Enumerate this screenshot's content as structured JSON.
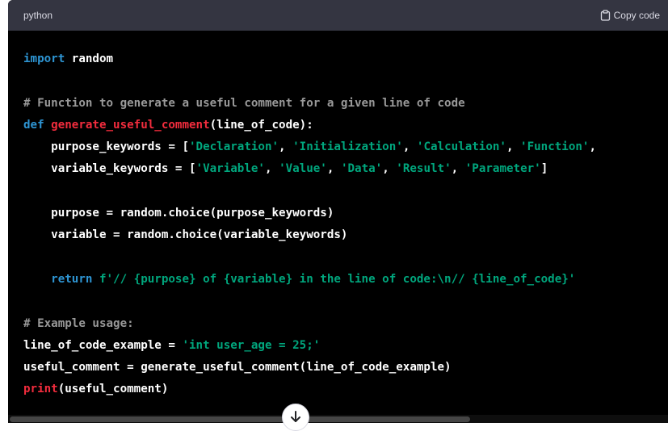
{
  "header": {
    "language": "python",
    "copy_label": "Copy code",
    "copy_icon": "clipboard-icon"
  },
  "colors": {
    "keyword": "#2e95d3",
    "function_name": "#f22c3d",
    "string": "#00a67d",
    "comment": "#999999",
    "text": "#ffffff",
    "header_bg": "#343541",
    "code_bg": "#000000"
  },
  "code_lines": [
    [
      {
        "t": "kw",
        "v": "import"
      },
      {
        "t": "tx",
        "v": " random"
      }
    ],
    [],
    [
      {
        "t": "cm",
        "v": "# Function to generate a useful comment for a given line of code"
      }
    ],
    [
      {
        "t": "kw",
        "v": "def"
      },
      {
        "t": "tx",
        "v": " "
      },
      {
        "t": "fn",
        "v": "generate_useful_comment"
      },
      {
        "t": "tx",
        "v": "(line_of_code):"
      }
    ],
    [
      {
        "t": "tx",
        "v": "    purpose_keywords = ["
      },
      {
        "t": "str",
        "v": "'Declaration'"
      },
      {
        "t": "tx",
        "v": ", "
      },
      {
        "t": "str",
        "v": "'Initialization'"
      },
      {
        "t": "tx",
        "v": ", "
      },
      {
        "t": "str",
        "v": "'Calculation'"
      },
      {
        "t": "tx",
        "v": ", "
      },
      {
        "t": "str",
        "v": "'Function'"
      },
      {
        "t": "tx",
        "v": ","
      }
    ],
    [
      {
        "t": "tx",
        "v": "    variable_keywords = ["
      },
      {
        "t": "str",
        "v": "'Variable'"
      },
      {
        "t": "tx",
        "v": ", "
      },
      {
        "t": "str",
        "v": "'Value'"
      },
      {
        "t": "tx",
        "v": ", "
      },
      {
        "t": "str",
        "v": "'Data'"
      },
      {
        "t": "tx",
        "v": ", "
      },
      {
        "t": "str",
        "v": "'Result'"
      },
      {
        "t": "tx",
        "v": ", "
      },
      {
        "t": "str",
        "v": "'Parameter'"
      },
      {
        "t": "tx",
        "v": "]"
      }
    ],
    [],
    [
      {
        "t": "tx",
        "v": "    purpose = random.choice(purpose_keywords)"
      }
    ],
    [
      {
        "t": "tx",
        "v": "    variable = random.choice(variable_keywords)"
      }
    ],
    [],
    [
      {
        "t": "tx",
        "v": "    "
      },
      {
        "t": "kw",
        "v": "return"
      },
      {
        "t": "tx",
        "v": " "
      },
      {
        "t": "str",
        "v": "f'// {purpose} of {variable} in the line of code:\\n// {line_of_code}'"
      }
    ],
    [],
    [
      {
        "t": "cm",
        "v": "# Example usage:"
      }
    ],
    [
      {
        "t": "tx",
        "v": "line_of_code_example = "
      },
      {
        "t": "str",
        "v": "'int user_age = 25;'"
      }
    ],
    [
      {
        "t": "tx",
        "v": "useful_comment = generate_useful_comment(line_of_code_example)"
      }
    ],
    [
      {
        "t": "fn",
        "v": "print"
      },
      {
        "t": "tx",
        "v": "(useful_comment)"
      }
    ]
  ],
  "scroll_button_icon": "arrow-down-icon"
}
